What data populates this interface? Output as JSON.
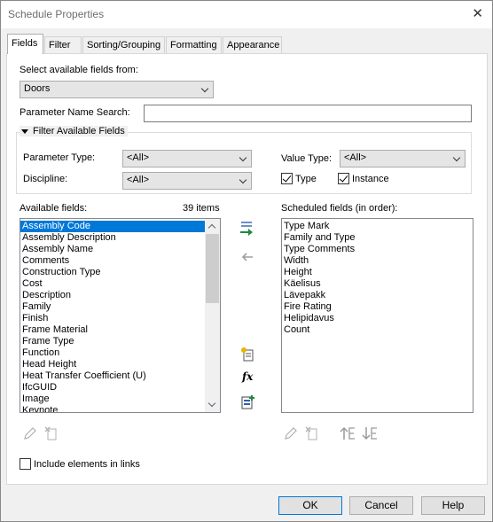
{
  "window": {
    "title": "Schedule Properties",
    "close_glyph": "✕"
  },
  "tabs": [
    {
      "label": "Fields"
    },
    {
      "label": "Filter"
    },
    {
      "label": "Sorting/Grouping"
    },
    {
      "label": "Formatting"
    },
    {
      "label": "Appearance"
    }
  ],
  "fields_tab": {
    "select_from_label": "Select available fields from:",
    "select_from_value": "Doors",
    "param_search_label": "Parameter Name Search:",
    "param_search_value": "",
    "filter_toggle_label": "Filter Available Fields",
    "parameter_type_label": "Parameter Type:",
    "parameter_type_value": "<All>",
    "discipline_label": "Discipline:",
    "discipline_value": "<All>",
    "value_type_label": "Value Type:",
    "value_type_value": "<All>",
    "type_checkbox": {
      "label": "Type",
      "checked": true
    },
    "instance_checkbox": {
      "label": "Instance",
      "checked": true
    },
    "available_label": "Available fields:",
    "available_count": "39 items",
    "available_fields": [
      "Assembly Code",
      "Assembly Description",
      "Assembly Name",
      "Comments",
      "Construction Type",
      "Cost",
      "Description",
      "Family",
      "Finish",
      "Frame Material",
      "Frame Type",
      "Function",
      "Head Height",
      "Heat Transfer Coefficient (U)",
      "IfcGUID",
      "Image",
      "Keynote"
    ],
    "available_selected": "Assembly Code",
    "scheduled_label": "Scheduled fields (in order):",
    "scheduled_fields": [
      "Type Mark",
      "Family and Type",
      "Type Comments",
      "Width",
      "Height",
      "Käelisus",
      "Lävepakk",
      "Fire Rating",
      "Helipidavus",
      "Count"
    ],
    "include_links_label": "Include elements in links",
    "include_links_checked": false,
    "fx_glyph": "fx"
  },
  "buttons": {
    "ok": "OK",
    "cancel": "Cancel",
    "help": "Help"
  },
  "colors": {
    "selection": "#0078d7",
    "add_arrow": "#1e8a3c",
    "accent_yellow": "#e8b400"
  }
}
